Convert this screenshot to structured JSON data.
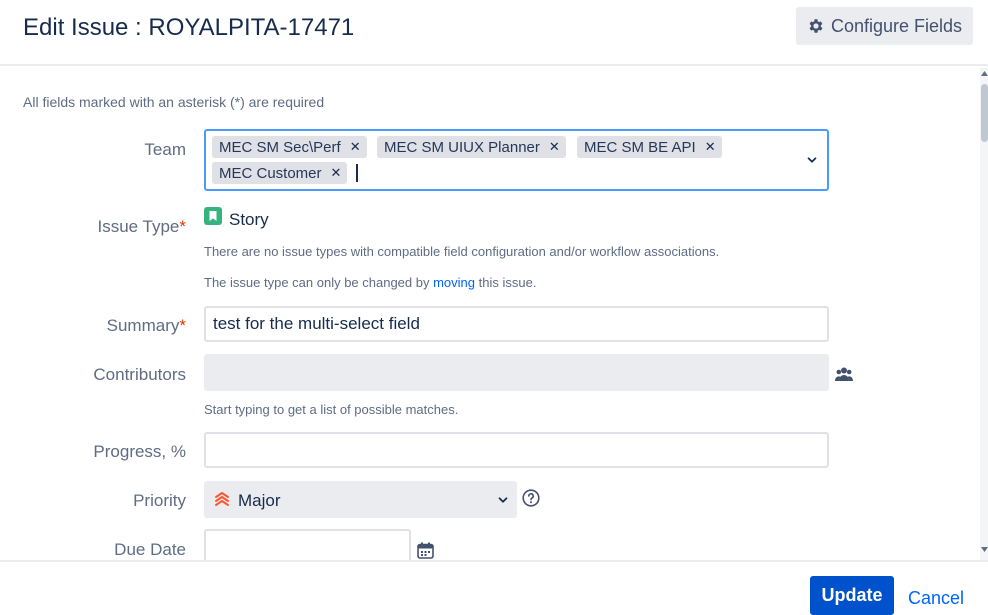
{
  "dialog": {
    "title": "Edit Issue : ROYALPITA-17471",
    "configure_fields_label": "Configure Fields"
  },
  "form": {
    "required_note": "All fields marked with an asterisk (*) are required",
    "team": {
      "label": "Team",
      "chips": [
        "MEC SM Sec\\Perf",
        "MEC SM UIUX Planner",
        "MEC SM BE API",
        "MEC Customer"
      ]
    },
    "issue_type": {
      "label": "Issue Type",
      "required_mark": "*",
      "value": "Story",
      "help_1": "There are no issue types with compatible field configuration and/or workflow associations.",
      "help_2_pre": "The issue type can only be changed by ",
      "help_2_link": "moving",
      "help_2_post": " this issue."
    },
    "summary": {
      "label": "Summary",
      "required_mark": "*",
      "value": "test for the multi-select field"
    },
    "contributors": {
      "label": "Contributors",
      "help": "Start typing to get a list of possible matches."
    },
    "progress": {
      "label": "Progress, %",
      "value": ""
    },
    "priority": {
      "label": "Priority",
      "value": "Major"
    },
    "due_date": {
      "label": "Due Date",
      "value": ""
    }
  },
  "footer": {
    "update_label": "Update",
    "cancel_label": "Cancel"
  },
  "colors": {
    "primary": "#0052cc",
    "focus_border": "#4c9aff",
    "story": "#36b37e",
    "priority_major": "#ff5630",
    "required": "#de350b"
  },
  "icons": [
    "gear-icon",
    "chip-remove-icon",
    "chevron-down-icon",
    "story-icon",
    "people-icon",
    "priority-major-icon",
    "help-circle-icon",
    "calendar-icon"
  ]
}
